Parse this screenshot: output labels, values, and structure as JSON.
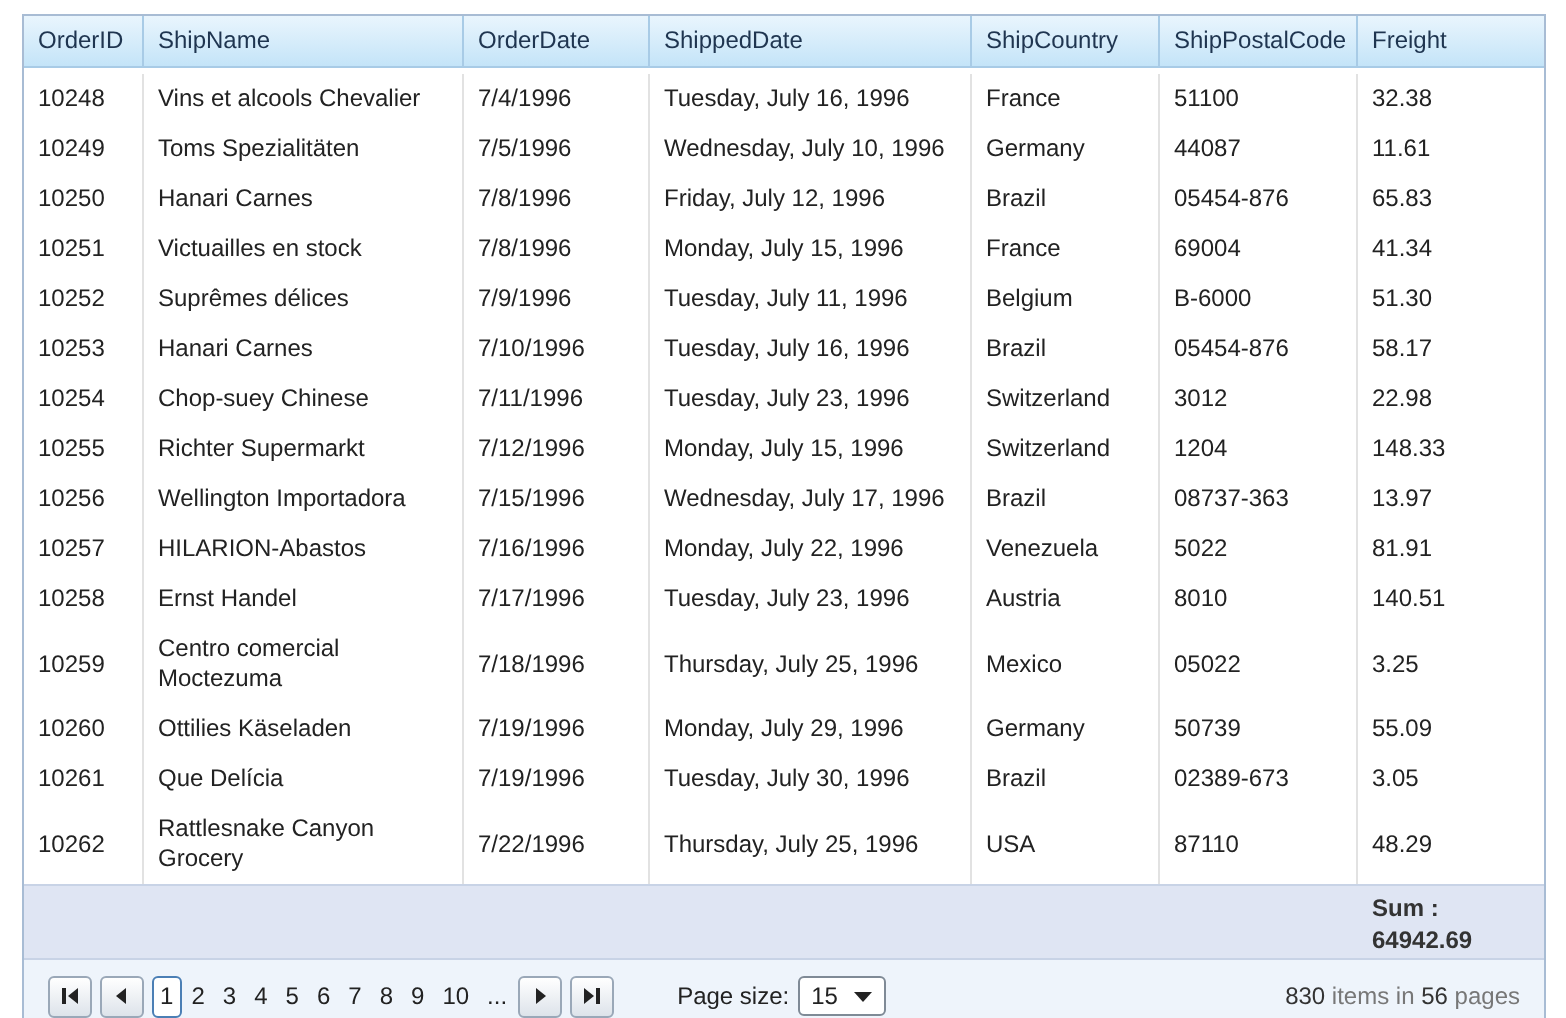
{
  "columns": [
    "OrderID",
    "ShipName",
    "OrderDate",
    "ShippedDate",
    "ShipCountry",
    "ShipPostalCode",
    "Freight"
  ],
  "rows": [
    [
      "10248",
      "Vins et alcools Chevalier",
      "7/4/1996",
      "Tuesday, July 16, 1996",
      "France",
      "51100",
      "32.38"
    ],
    [
      "10249",
      "Toms Spezialitäten",
      "7/5/1996",
      "Wednesday, July 10, 1996",
      "Germany",
      "44087",
      "11.61"
    ],
    [
      "10250",
      "Hanari Carnes",
      "7/8/1996",
      "Friday, July 12, 1996",
      "Brazil",
      "05454-876",
      "65.83"
    ],
    [
      "10251",
      "Victuailles en stock",
      "7/8/1996",
      "Monday, July 15, 1996",
      "France",
      "69004",
      "41.34"
    ],
    [
      "10252",
      "Suprêmes délices",
      "7/9/1996",
      "Tuesday, July 11, 1996",
      "Belgium",
      "B-6000",
      "51.30"
    ],
    [
      "10253",
      "Hanari Carnes",
      "7/10/1996",
      "Tuesday, July 16, 1996",
      "Brazil",
      "05454-876",
      "58.17"
    ],
    [
      "10254",
      "Chop-suey Chinese",
      "7/11/1996",
      "Tuesday, July 23, 1996",
      "Switzerland",
      "3012",
      "22.98"
    ],
    [
      "10255",
      "Richter Supermarkt",
      "7/12/1996",
      "Monday, July 15, 1996",
      "Switzerland",
      "1204",
      "148.33"
    ],
    [
      "10256",
      "Wellington Importadora",
      "7/15/1996",
      "Wednesday, July 17, 1996",
      "Brazil",
      "08737-363",
      "13.97"
    ],
    [
      "10257",
      "HILARION-Abastos",
      "7/16/1996",
      "Monday, July 22, 1996",
      "Venezuela",
      "5022",
      "81.91"
    ],
    [
      "10258",
      "Ernst Handel",
      "7/17/1996",
      "Tuesday, July 23, 1996",
      "Austria",
      "8010",
      "140.51"
    ],
    [
      "10259",
      "Centro comercial Moctezuma",
      "7/18/1996",
      "Thursday, July 25, 1996",
      "Mexico",
      "05022",
      "3.25"
    ],
    [
      "10260",
      "Ottilies Käseladen",
      "7/19/1996",
      "Monday, July 29, 1996",
      "Germany",
      "50739",
      "55.09"
    ],
    [
      "10261",
      "Que Delícia",
      "7/19/1996",
      "Tuesday, July 30, 1996",
      "Brazil",
      "02389-673",
      "3.05"
    ],
    [
      "10262",
      "Rattlesnake Canyon Grocery",
      "7/22/1996",
      "Thursday, July 25, 1996",
      "USA",
      "87110",
      "48.29"
    ]
  ],
  "footer": {
    "sum_label": "Sum :",
    "sum_value": "64942.69"
  },
  "pager": {
    "pages": [
      {
        "label": "1",
        "selected": true
      },
      {
        "label": "2",
        "selected": false
      },
      {
        "label": "3",
        "selected": false
      },
      {
        "label": "4",
        "selected": false
      },
      {
        "label": "5",
        "selected": false
      },
      {
        "label": "6",
        "selected": false
      },
      {
        "label": "7",
        "selected": false
      },
      {
        "label": "8",
        "selected": false
      },
      {
        "label": "9",
        "selected": false
      },
      {
        "label": "10",
        "selected": false
      },
      {
        "label": "...",
        "selected": false
      }
    ],
    "page_size_label": "Page size:",
    "page_size": "15",
    "info": "**830** items in **56** pages"
  }
}
